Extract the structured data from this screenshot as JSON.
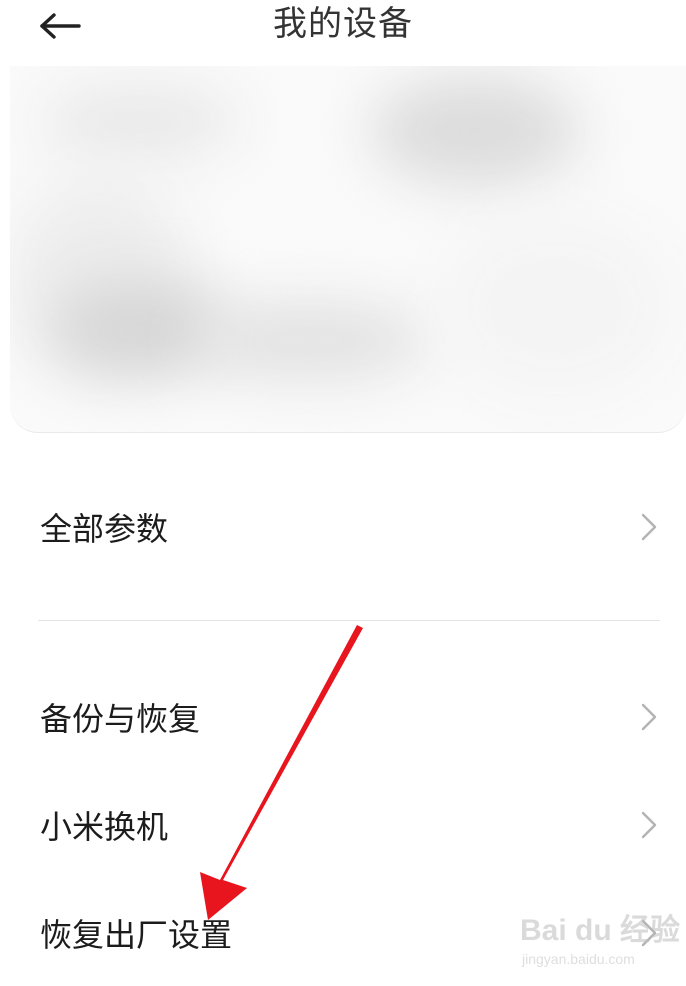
{
  "header": {
    "title": "我的设备",
    "back_icon": "arrow-left-icon"
  },
  "menu": {
    "items": [
      {
        "label": "全部参数",
        "icon": "chevron-right-icon"
      },
      {
        "label": "备份与恢复",
        "icon": "chevron-right-icon"
      },
      {
        "label": "小米换机",
        "icon": "chevron-right-icon"
      },
      {
        "label": "恢复出厂设置",
        "icon": "chevron-right-icon"
      }
    ]
  },
  "annotation": {
    "color": "#e8141e"
  },
  "watermark": {
    "logo": "Bai du 经验",
    "url": "jingyan.baidu.com"
  }
}
